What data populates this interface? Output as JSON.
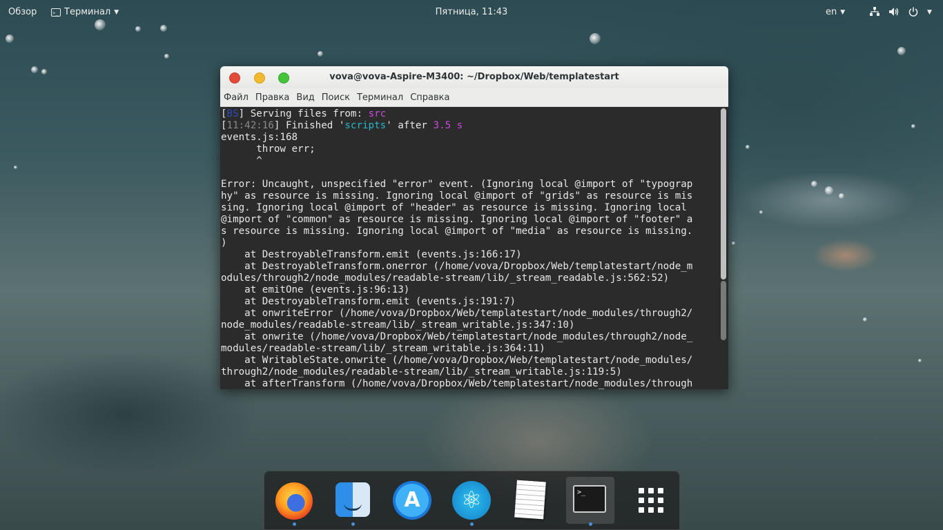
{
  "topbar": {
    "overview": "Обзор",
    "app_menu": "Терминал",
    "clock": "Пятница, 11:43",
    "lang": "en"
  },
  "window": {
    "title": "vova@vova-Aspire-M3400: ~/Dropbox/Web/templatestart",
    "menu": [
      "Файл",
      "Правка",
      "Вид",
      "Поиск",
      "Терминал",
      "Справка"
    ]
  },
  "terminal": {
    "line1_prefix_open": "[",
    "line1_bs": "BS",
    "line1_rest": "] Serving files from: ",
    "line1_src": "src",
    "line2_open": "[",
    "line2_time": "11:42:16",
    "line2_finished": "] Finished '",
    "line2_task": "scripts",
    "line2_after": "' after ",
    "line2_duration": "3.5 s",
    "body": "events.js:168\n      throw err;\n      ^\n\nError: Uncaught, unspecified \"error\" event. (Ignoring local @import of \"typograp\nhy\" as resource is missing. Ignoring local @import of \"grids\" as resource is mis\nsing. Ignoring local @import of \"header\" as resource is missing. Ignoring local \n@import of \"common\" as resource is missing. Ignoring local @import of \"footer\" a\ns resource is missing. Ignoring local @import of \"media\" as resource is missing.\n)\n    at DestroyableTransform.emit (events.js:166:17)\n    at DestroyableTransform.onerror (/home/vova/Dropbox/Web/templatestart/node_m\nodules/through2/node_modules/readable-stream/lib/_stream_readable.js:562:52)\n    at emitOne (events.js:96:13)\n    at DestroyableTransform.emit (events.js:191:7)\n    at onwriteError (/home/vova/Dropbox/Web/templatestart/node_modules/through2/\nnode_modules/readable-stream/lib/_stream_writable.js:347:10)\n    at onwrite (/home/vova/Dropbox/Web/templatestart/node_modules/through2/node_\nmodules/readable-stream/lib/_stream_writable.js:364:11)\n    at WritableState.onwrite (/home/vova/Dropbox/Web/templatestart/node_modules/\nthrough2/node_modules/readable-stream/lib/_stream_writable.js:119:5)\n    at afterTransform (/home/vova/Dropbox/Web/templatestart/node_modules/through"
  },
  "dock": {
    "items": [
      {
        "icon": "firefox-icon"
      },
      {
        "icon": "finder-icon"
      },
      {
        "icon": "app-store-icon"
      },
      {
        "icon": "atom-icon"
      },
      {
        "icon": "notes-icon"
      },
      {
        "icon": "terminal-icon",
        "symbol": ">_"
      },
      {
        "icon": "app-grid-icon"
      }
    ]
  },
  "colors": {
    "terminal_bg": "#2b2b2b",
    "accent_magenta": "#c74dd8",
    "accent_cyan": "#27b5c8",
    "running_dot": "#4a90d9"
  }
}
